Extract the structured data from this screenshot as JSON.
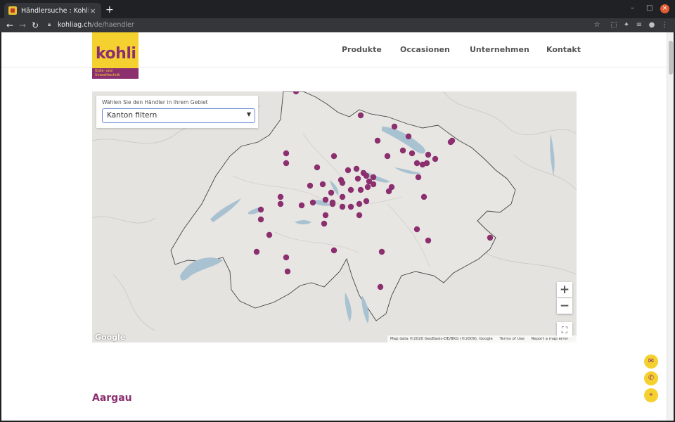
{
  "browser": {
    "tab_title": "Händlersuche : Kohli AG",
    "tab_close": "×",
    "new_tab": "+",
    "url_domain": "kohliag.ch",
    "url_path": "/de/haendler",
    "window_buttons": [
      "–",
      "□",
      "×"
    ]
  },
  "site": {
    "logo_word": "kohli",
    "logo_sub_line1": "Gülle- und",
    "logo_sub_line2": "Umwelttechnik",
    "nav": [
      "Produkte",
      "Occasionen",
      "Unternehmen",
      "Kontakt"
    ]
  },
  "map": {
    "filter_label": "Wählen Sie den Händler in Ihrem Gebiet",
    "filter_select_value": "Kanton filtern",
    "zoom_in": "+",
    "zoom_out": "−",
    "fullscreen": "⛶",
    "google_logo": "Google",
    "attribution": [
      "Map data ©2020 GeoBasis-DE/BKG (©2009), Google",
      "Terms of Use",
      "Report a map error"
    ],
    "marker_color": "#8b2f6f",
    "markers_count": 66
  },
  "fab_icons": [
    "mail-icon",
    "phone-icon",
    "location-icon"
  ],
  "section_title": "Aargau",
  "colors": {
    "brand_purple": "#8b2f6f",
    "brand_yellow": "#f5d130",
    "map_land": "#e4e3df",
    "map_water": "#a9c2d2"
  }
}
